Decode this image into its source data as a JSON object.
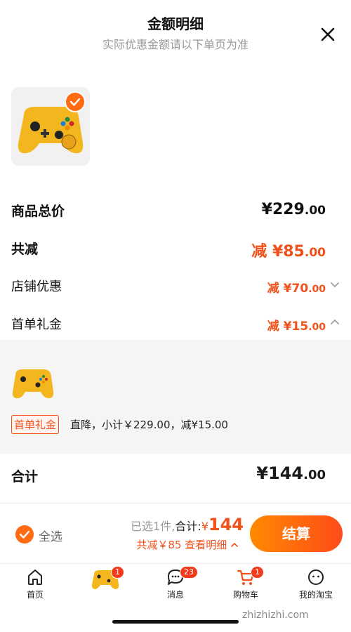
{
  "header": {
    "title": "金额明细",
    "subtitle": "实际优惠金额请以下单页为准"
  },
  "product": {
    "image": "yellow game controller",
    "selected": true
  },
  "rows": {
    "total_price": {
      "label": "商品总价",
      "sym": "¥",
      "int": "229",
      "cents": ".00"
    },
    "total_reduction": {
      "label": "共减",
      "prefix": "减",
      "sym": "¥",
      "int": "85",
      "cents": ".00"
    },
    "shop_discount": {
      "label": "店铺优惠",
      "prefix": "减",
      "sym": "¥",
      "int": "70",
      "cents": ".00",
      "icon": "chevron-down-icon"
    },
    "first_order_gift": {
      "label": "首单礼金",
      "prefix": "减",
      "sym": "¥",
      "int": "15",
      "cents": ".00",
      "icon": "chevron-up-icon"
    }
  },
  "detail": {
    "tag": "首单礼金",
    "text": "直降，小计￥229.00，减¥15.00"
  },
  "summary": {
    "label": "合计",
    "sym": "¥",
    "int": "144",
    "cents": ".00"
  },
  "bottom_bar": {
    "select_all": "全选",
    "selected_prefix": "已选1件,",
    "total_label": "合计:",
    "total_sym": "¥",
    "total_amount": "144",
    "savings_text": "共减￥85",
    "view_details": "查看明细",
    "checkout": "结算"
  },
  "tabbar": [
    {
      "label": "首页",
      "icon": "home-icon"
    },
    {
      "label": "",
      "icon": "product-thumbnail",
      "badge": "1"
    },
    {
      "label": "消息",
      "icon": "message-icon",
      "badge": "23"
    },
    {
      "label": "购物车",
      "icon": "cart-icon",
      "badge": "1"
    },
    {
      "label": "我的淘宝",
      "icon": "profile-icon"
    }
  ],
  "watermark": "zhizhizhi.com",
  "colors": {
    "accent": "#f2501a",
    "checkout_start": "#ff8a00",
    "checkout_end": "#ff4b1a"
  }
}
